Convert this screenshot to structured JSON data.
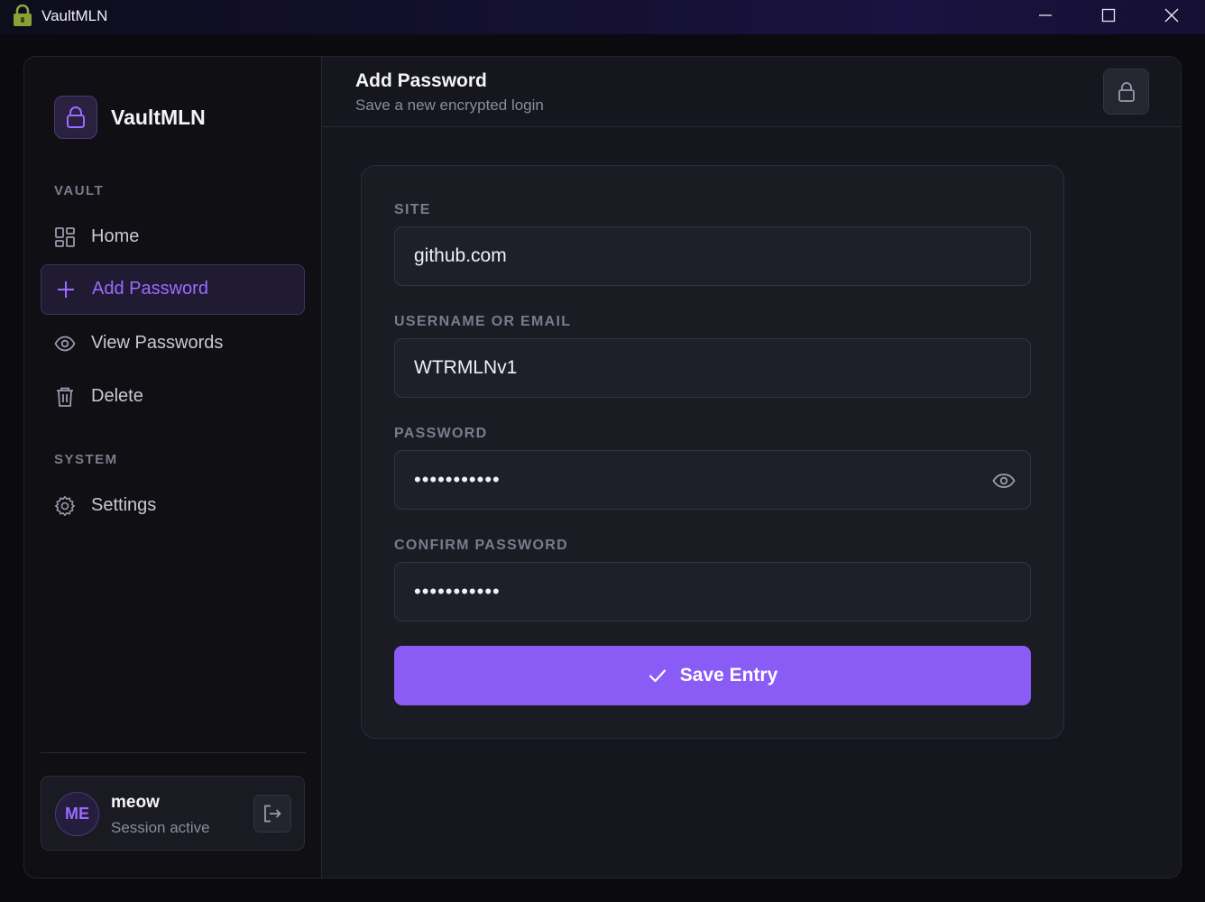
{
  "window": {
    "title": "VaultMLN",
    "icons": [
      "padlock-app-icon",
      "minimize-icon",
      "maximize-icon",
      "close-icon"
    ]
  },
  "sidebar": {
    "brand": "VaultMLN",
    "sections": {
      "vault": "VAULT",
      "system": "SYSTEM"
    },
    "items": [
      {
        "label": "Home",
        "icon": "grid-icon",
        "active": false
      },
      {
        "label": "Add Password",
        "icon": "plus-icon",
        "active": true
      },
      {
        "label": "View Passwords",
        "icon": "eye-icon",
        "active": false
      },
      {
        "label": "Delete",
        "icon": "trash-icon",
        "active": false
      },
      {
        "label": "Settings",
        "icon": "gear-icon",
        "active": false
      }
    ],
    "user": {
      "initials": "ME",
      "name": "meow",
      "status": "Session active"
    }
  },
  "header": {
    "title": "Add Password",
    "subtitle": "Save a new encrypted login"
  },
  "form": {
    "site": {
      "label": "SITE",
      "value": "github.com"
    },
    "username": {
      "label": "USERNAME OR EMAIL",
      "value": "WTRMLNv1"
    },
    "password": {
      "label": "PASSWORD",
      "value": "•••••••••••"
    },
    "confirm": {
      "label": "CONFIRM PASSWORD",
      "value": "•••••••••••"
    },
    "save_label": "Save Entry"
  },
  "colors": {
    "accent": "#8a5cf5",
    "accent_text": "#9b6cff",
    "background": "#16161e",
    "sidebar": "#0f0f14"
  }
}
